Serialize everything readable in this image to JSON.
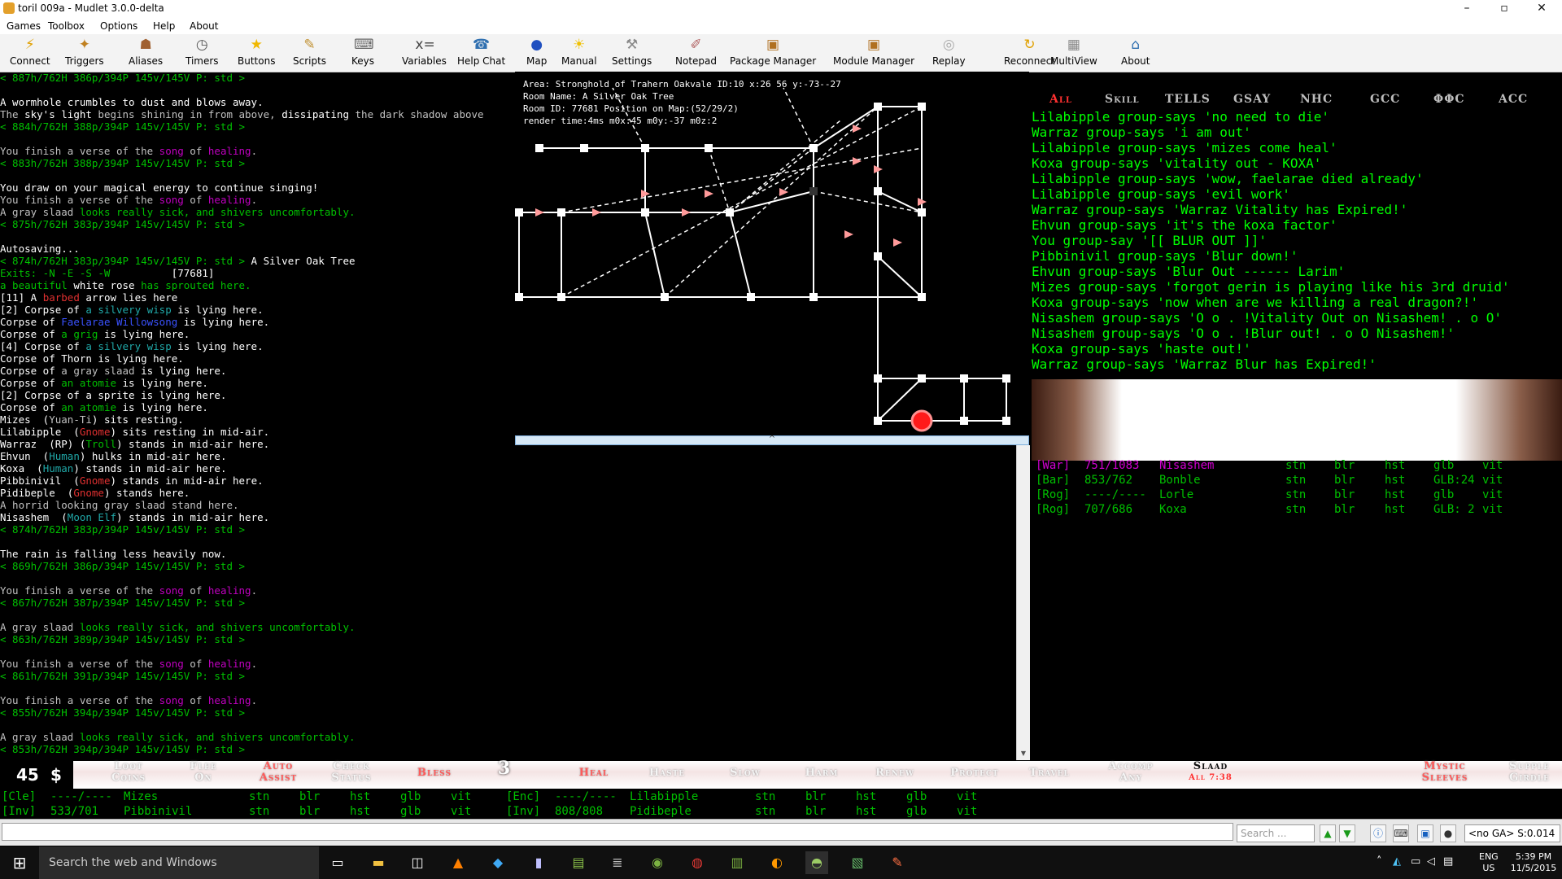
{
  "window": {
    "title": "toril 009a - Mudlet 3.0.0-delta",
    "min": "–",
    "max": "▫",
    "close": "✕"
  },
  "menu": [
    "Games",
    "Toolbox",
    "Options",
    "Help",
    "About"
  ],
  "toolbar": [
    {
      "label": "Connect",
      "icon": "⚡",
      "color": "#e0a000"
    },
    {
      "label": "Triggers",
      "icon": "✦",
      "color": "#c08020"
    },
    {
      "label": "Aliases",
      "icon": "☗",
      "color": "#a06030"
    },
    {
      "label": "Timers",
      "icon": "◷",
      "color": "#555555"
    },
    {
      "label": "Buttons",
      "icon": "★",
      "color": "#f0b800"
    },
    {
      "label": "Scripts",
      "icon": "✎",
      "color": "#c09030"
    },
    {
      "label": "Keys",
      "icon": "⌨",
      "color": "#666666"
    },
    {
      "label": "Variables",
      "icon": "x=",
      "color": "#444444"
    },
    {
      "label": "Help Chat",
      "icon": "☎",
      "color": "#3070b0"
    },
    {
      "label": "Map",
      "icon": "●",
      "color": "#2050c0"
    },
    {
      "label": "Manual",
      "icon": "☀",
      "color": "#f0c000"
    },
    {
      "label": "Settings",
      "icon": "⚒",
      "color": "#888888"
    },
    {
      "label": "Notepad",
      "icon": "✐",
      "color": "#b06060"
    },
    {
      "label": "Package Manager",
      "icon": "▣",
      "color": "#b07020"
    },
    {
      "label": "Module Manager",
      "icon": "▣",
      "color": "#b07020"
    },
    {
      "label": "Replay",
      "icon": "◎",
      "color": "#aaaaaa"
    },
    {
      "label": "Reconnect",
      "icon": "↻",
      "color": "#e0a000"
    },
    {
      "label": "MultiView",
      "icon": "▦",
      "color": "#888888"
    },
    {
      "label": "About",
      "icon": "⌂",
      "color": "#3070b0"
    }
  ],
  "main_output": [
    [
      [
        "< 887h/762H 386p/394P 145v/145V P: std >",
        "prompt"
      ]
    ],
    [],
    [
      [
        "A wormhole crumbles to dust and blows away.",
        "white"
      ]
    ],
    [
      [
        "The ",
        "gray"
      ],
      [
        "sky's light",
        "white"
      ],
      [
        " begins shining in from above, ",
        "gray"
      ],
      [
        "dissipating",
        "white"
      ],
      [
        " the dark shadow above",
        "gray"
      ]
    ],
    [
      [
        "< 884h/762H 388p/394P 145v/145V P: std >",
        "prompt"
      ]
    ],
    [],
    [
      [
        "You finish a verse of the ",
        "gray"
      ],
      [
        "song",
        "purple"
      ],
      [
        " of ",
        "gray"
      ],
      [
        "healing",
        "purple"
      ],
      [
        ".",
        "gray"
      ]
    ],
    [
      [
        "< 883h/762H 388p/394P 145v/145V P: std >",
        "prompt"
      ]
    ],
    [],
    [
      [
        "You draw on your magical energy to continue singing!",
        "white"
      ]
    ],
    [
      [
        "You finish a verse of the ",
        "gray"
      ],
      [
        "song",
        "purple"
      ],
      [
        " of ",
        "gray"
      ],
      [
        "healing",
        "purple"
      ],
      [
        ".",
        "gray"
      ]
    ],
    [
      [
        "A gray slaad ",
        "gray"
      ],
      [
        "looks really sick, and shivers uncomfortably.",
        "grn"
      ]
    ],
    [
      [
        "< 875h/762H 383p/394P 145v/145V P: std >",
        "prompt"
      ]
    ],
    [],
    [
      [
        "Autosaving...",
        "white"
      ]
    ],
    [
      [
        "< 874h/762H 383p/394P 145v/145V P: std >",
        "prompt"
      ],
      [
        " A Silver Oak Tree",
        "white"
      ]
    ],
    [
      [
        "Exits: -N -E -S -W",
        "prompt"
      ],
      [
        "          [77681]",
        "white"
      ]
    ],
    [
      [
        "a beautiful ",
        "grn"
      ],
      [
        "white rose",
        "white"
      ],
      [
        " has sprouted here.",
        "grn"
      ]
    ],
    [
      [
        "[11] A ",
        "white"
      ],
      [
        "barbed",
        "red"
      ],
      [
        " arrow lies here",
        "white"
      ]
    ],
    [
      [
        "[2] Corpse of ",
        "white"
      ],
      [
        "a silvery wisp",
        "cyan"
      ],
      [
        " is lying here.",
        "white"
      ]
    ],
    [
      [
        "Corpse of ",
        "white"
      ],
      [
        "Faelarae Willowsong",
        "blue"
      ],
      [
        " is lying here.",
        "white"
      ]
    ],
    [
      [
        "Corpse of ",
        "white"
      ],
      [
        "a grig",
        "grn"
      ],
      [
        " is lying here.",
        "white"
      ]
    ],
    [
      [
        "[4] Corpse of ",
        "white"
      ],
      [
        "a silvery wisp",
        "cyan"
      ],
      [
        " is lying here.",
        "white"
      ]
    ],
    [
      [
        "Corpse of Thorn is lying here.",
        "white"
      ]
    ],
    [
      [
        "Corpse of ",
        "white"
      ],
      [
        "a gray slaad",
        "gray"
      ],
      [
        " is lying here.",
        "white"
      ]
    ],
    [
      [
        "Corpse of ",
        "white"
      ],
      [
        "an atomie",
        "grn"
      ],
      [
        " is lying here.",
        "white"
      ]
    ],
    [
      [
        "[2] Corpse of ",
        "white"
      ],
      [
        "a sprite",
        "white"
      ],
      [
        " is lying here.",
        "white"
      ]
    ],
    [
      [
        "Corpse of ",
        "white"
      ],
      [
        "an atomie",
        "grn"
      ],
      [
        " is lying here.",
        "white"
      ]
    ],
    [
      [
        "Mizes  (",
        "white"
      ],
      [
        "Yuan-Ti",
        "gray"
      ],
      [
        ") sits resting.",
        "white"
      ]
    ],
    [
      [
        "Lilabipple  (",
        "white"
      ],
      [
        "Gnome",
        "red"
      ],
      [
        ") sits resting in mid-air.",
        "white"
      ]
    ],
    [
      [
        "Warraz  (RP) (",
        "white"
      ],
      [
        "Troll",
        "grn"
      ],
      [
        ") stands in mid-air here.",
        "white"
      ]
    ],
    [
      [
        "Ehvun  (",
        "white"
      ],
      [
        "Human",
        "cyan"
      ],
      [
        ") hulks in mid-air here.",
        "white"
      ]
    ],
    [
      [
        "Koxa  (",
        "white"
      ],
      [
        "Human",
        "cyan"
      ],
      [
        ") stands in mid-air here.",
        "white"
      ]
    ],
    [
      [
        "Pibbinivil  (",
        "white"
      ],
      [
        "Gnome",
        "red"
      ],
      [
        ") stands in mid-air here.",
        "white"
      ]
    ],
    [
      [
        "Pidibeple  (",
        "white"
      ],
      [
        "Gnome",
        "red"
      ],
      [
        ") stands here.",
        "white"
      ]
    ],
    [
      [
        "A horrid looking gray slaad stand here.",
        "gray"
      ]
    ],
    [
      [
        "Nisashem  (",
        "white"
      ],
      [
        "Moon Elf",
        "cyan"
      ],
      [
        ") stands in mid-air here.",
        "white"
      ]
    ],
    [
      [
        "< 874h/762H 383p/394P 145v/145V P: std >",
        "prompt"
      ]
    ],
    [],
    [
      [
        "The rain is falling less heavily now.",
        "white"
      ]
    ],
    [
      [
        "< 869h/762H 386p/394P 145v/145V P: std >",
        "prompt"
      ]
    ],
    [],
    [
      [
        "You finish a verse of the ",
        "gray"
      ],
      [
        "song",
        "purple"
      ],
      [
        " of ",
        "gray"
      ],
      [
        "healing",
        "purple"
      ],
      [
        ".",
        "gray"
      ]
    ],
    [
      [
        "< 867h/762H 387p/394P 145v/145V P: std >",
        "prompt"
      ]
    ],
    [],
    [
      [
        "A gray slaad ",
        "gray"
      ],
      [
        "looks really sick, and shivers uncomfortably.",
        "grn"
      ]
    ],
    [
      [
        "< 863h/762H 389p/394P 145v/145V P: std >",
        "prompt"
      ]
    ],
    [],
    [
      [
        "You finish a verse of the ",
        "gray"
      ],
      [
        "song",
        "purple"
      ],
      [
        " of ",
        "gray"
      ],
      [
        "healing",
        "purple"
      ],
      [
        ".",
        "gray"
      ]
    ],
    [
      [
        "< 861h/762H 391p/394P 145v/145V P: std >",
        "prompt"
      ]
    ],
    [],
    [
      [
        "You finish a verse of the ",
        "gray"
      ],
      [
        "song",
        "purple"
      ],
      [
        " of ",
        "gray"
      ],
      [
        "healing",
        "purple"
      ],
      [
        ".",
        "gray"
      ]
    ],
    [
      [
        "< 855h/762H 394p/394P 145v/145V P: std >",
        "prompt"
      ]
    ],
    [],
    [
      [
        "A gray slaad ",
        "gray"
      ],
      [
        "looks really sick, and shivers uncomfortably.",
        "grn"
      ]
    ],
    [
      [
        "< 853h/762H 394p/394P 145v/145V P: std >",
        "prompt"
      ]
    ]
  ],
  "map": {
    "info": [
      "Area: Stronghold of Trahern Oakvale ID:10 x:26 56 y:-73--27",
      "Room Name: A Silver Oak Tree",
      "Room ID: 77681 Position on Map:(52/29/2)",
      "render time:4ms m0x:45 m0y:-37 m0z:2"
    ],
    "splitter": "^"
  },
  "chat_tabs": [
    {
      "label": "All",
      "active": true
    },
    {
      "label": "Skill",
      "active": false
    },
    {
      "label": "TELLS",
      "active": false
    },
    {
      "label": "GSAY",
      "active": false
    },
    {
      "label": "NHC",
      "active": false
    },
    {
      "label": "GCC",
      "active": false
    },
    {
      "label": "ΦΦC",
      "active": false
    },
    {
      "label": "ACC",
      "active": false
    }
  ],
  "chat_lines": [
    "Lilabipple group-says 'no need to die'",
    "Warraz group-says 'i am out'",
    "Lilabipple group-says 'mizes come heal'",
    "Koxa group-says 'vitality out - KOXA'",
    "Lilabipple group-says 'wow, faelarae died already'",
    "Lilabipple group-says 'evil work'",
    "Warraz group-says 'Warraz Vitality has Expired!'",
    "Ehvun group-says 'it's the koxa factor'",
    "You group-say '[[ BLUR OUT ]]'",
    "Pibbinivil group-says 'Blur down!'",
    "Ehvun group-says 'Blur Out ------ Larim'",
    "Mizes group-says 'forgot gerin is playing like his 3rd druid'",
    "Koxa group-says 'now when are we killing a real dragon?!'",
    "Nisashem group-says 'O o . !Vitality Out on Nisashem! . o O'",
    "Nisashem group-says 'O o . !Blur out! . o O Nisashem!'",
    "Koxa group-says 'haste out!'",
    "Warraz group-says 'Warraz Blur has Expired!'"
  ],
  "group_rows": [
    {
      "cls": "[War]",
      "hp": "751/1083",
      "name": "Nisashem",
      "highlight": true,
      "a": "stn",
      "b": "blr",
      "c": "hst",
      "d": "glb",
      "e": "vit"
    },
    {
      "cls": "[Bar]",
      "hp": "853/762",
      "name": "Bonble",
      "highlight": false,
      "a": "stn",
      "b": "blr",
      "c": "hst",
      "d": "GLB:24",
      "e": "vit"
    },
    {
      "cls": "[Rog]",
      "hp": "----/----",
      "name": "Lorle",
      "highlight": false,
      "a": "stn",
      "b": "blr",
      "c": "hst",
      "d": "glb",
      "e": "vit"
    },
    {
      "cls": "[Rog]",
      "hp": "707/686",
      "name": "Koxa",
      "highlight": false,
      "a": "stn",
      "b": "blr",
      "c": "hst",
      "d": "GLB: 2",
      "e": "vit"
    }
  ],
  "counter": {
    "value": "45",
    "symbol": "$"
  },
  "buttons": [
    {
      "l1": "Loot",
      "l2": "Coins",
      "style": "light"
    },
    {
      "l1": "Flee",
      "l2": "On",
      "style": "light"
    },
    {
      "l1": "Auto",
      "l2": "Assist",
      "style": "red"
    },
    {
      "l1": "Check",
      "l2": "Status",
      "style": "light"
    },
    {
      "l1": "Bless",
      "l2": "",
      "style": "red"
    },
    {
      "l1": "3",
      "l2": "",
      "style": "light"
    },
    {
      "l1": "Heal",
      "l2": "",
      "style": "red"
    },
    {
      "l1": "Haste",
      "l2": "",
      "style": "light"
    },
    {
      "l1": "Slow",
      "l2": "",
      "style": "light"
    },
    {
      "l1": "Harm",
      "l2": "",
      "style": "light"
    },
    {
      "l1": "Renew",
      "l2": "",
      "style": "light"
    },
    {
      "l1": "Protect",
      "l2": "",
      "style": "light"
    },
    {
      "l1": "Travel",
      "l2": "",
      "style": "light"
    },
    {
      "l1": "Accomp",
      "l2": "Any",
      "style": "light"
    },
    {
      "l1": "Slaad",
      "l2": "All 7:38",
      "style": "dark"
    },
    {
      "l1": "Mystic",
      "l2": "Sleeves",
      "style": "red"
    },
    {
      "l1": "Supple",
      "l2": "Girdle",
      "style": "light"
    }
  ],
  "status_rows": [
    {
      "c1": "[Cle]",
      "h1": "----/----",
      "n1": "Mizes",
      "c2": "[Enc]",
      "h2": "----/----",
      "n2": "Lilabipple"
    },
    {
      "c1": "[Inv]",
      "h1": "533/701",
      "n1": "Pibbinivil",
      "c2": "[Inv]",
      "h2": "808/808",
      "n2": "Pidibeple"
    }
  ],
  "status_flags": {
    "a": "stn",
    "b": "blr",
    "c": "hst",
    "d": "glb",
    "e": "vit"
  },
  "input": {
    "command_value": "",
    "search_placeholder": "Search ...",
    "ga_status": "<no GA> S:0.014"
  },
  "taskbar": {
    "search_placeholder": "Search the web and Windows",
    "lang": "ENG",
    "region": "US",
    "time": "5:39 PM",
    "date": "11/5/2015"
  },
  "colors": {
    "prompt": "#00c000",
    "white": "#ffffff",
    "gray": "#c0c0c0",
    "purple": "#c000c0",
    "red": "#e03030",
    "blue": "#3a52ff",
    "cyan": "#20a8a8",
    "grn": "#00c000",
    "nisashem": "#d000d0"
  }
}
